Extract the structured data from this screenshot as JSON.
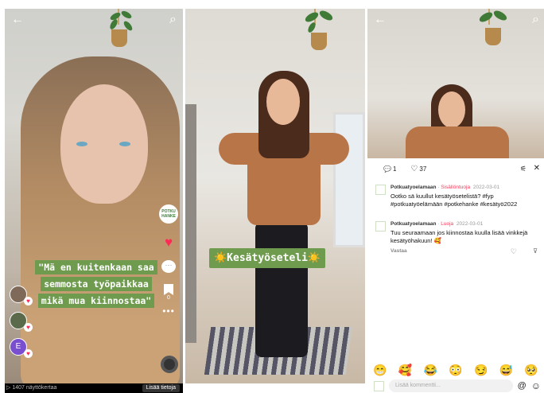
{
  "panel1": {
    "caption": "\"Mä en kuitenkaan saa semmosta työpaikkaa mikä mua kiinnostaa\"",
    "views": "1407 näyttökertaa",
    "more_info_label": "Lisää tietoja",
    "save_count": "0",
    "profile_logo_text": "POTKU HANKE",
    "commenter_initial": "E"
  },
  "panel2": {
    "caption": "☀️Kesätyöseteli☀️"
  },
  "panel3": {
    "comment_count": "1",
    "like_count": "37",
    "comments": [
      {
        "author": "Potkuatyoelamaan",
        "role": "Sisällöntuoja",
        "date": "2022-03-01",
        "text": "Ootko sä kuullut kesätyösetelistä? #fyp #potkuatyöelämään #potkehanke #kesätyö2022"
      },
      {
        "author": "Potkuatyoelamaan",
        "role": "Luoja",
        "date": "2022-03-01",
        "text": "Tuu seuraamaan jos kiinnostaa kuulla lisää vinkkejä kesätyöhakuun! 🥰",
        "reply_label": "Vastaa"
      }
    ],
    "emojis": [
      "😁",
      "🥰",
      "😂",
      "😳",
      "😏",
      "😅",
      "🥺"
    ],
    "input_placeholder": "Lisää kommentti...",
    "at_symbol": "@",
    "emoji_button": "☺"
  }
}
